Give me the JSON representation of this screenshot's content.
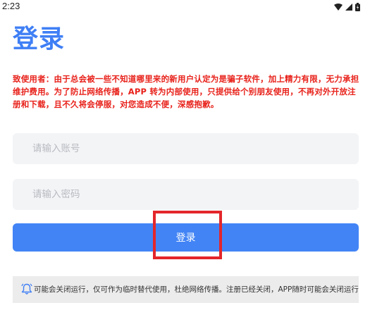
{
  "status_bar": {
    "time": "2:23",
    "icons": [
      "wifi-icon",
      "signal-icon",
      "battery-icon"
    ]
  },
  "title": "登录",
  "notice": "致使用者：由于总会被一些不知道哪里来的新用户认定为是骗子软件，加上精力有限，无力承担维护费用。为了防止网络传播，APP 转为内部使用，只提供给个别朋友使用，不再对外开放注册和下载，且不久将会停服，对您造成不便，深感抱歉。",
  "form": {
    "account_placeholder": "请输入账号",
    "password_placeholder": "请输入密码",
    "account_value": "",
    "password_value": "",
    "login_label": "登录"
  },
  "marquee": {
    "icon": "bell-icon",
    "text": "可能会关闭运行，仅可作为临时替代使用，杜绝网络传播。注册已经关闭，APP随时可能会关闭运行"
  },
  "colors": {
    "accent": "#4284f5",
    "title": "#3f7ff5",
    "warning": "#e8221b",
    "highlight": "#e3262b"
  }
}
